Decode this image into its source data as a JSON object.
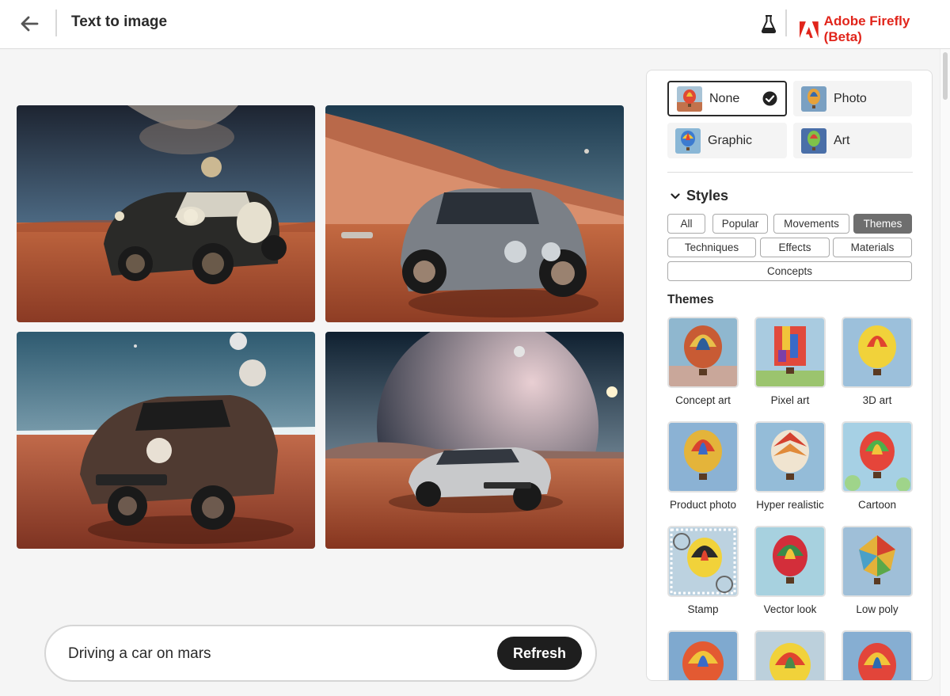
{
  "header": {
    "title": "Text to image",
    "brand_name": "Adobe Firefly (Beta)",
    "brand_color": "#e1251b",
    "back_icon": "arrow-left-icon",
    "labs_icon": "flask-icon"
  },
  "results": {
    "images": [
      {
        "alt": "Vintage car on mars with milky way"
      },
      {
        "alt": "Round silver car in red desert canyon"
      },
      {
        "alt": "Brown sports car with moons overhead"
      },
      {
        "alt": "Silver sports car with giant planet"
      }
    ]
  },
  "prompt": {
    "value": "Driving a car on mars",
    "refresh_label": "Refresh"
  },
  "panel": {
    "content_types": [
      {
        "label": "None",
        "selected": true
      },
      {
        "label": "Photo",
        "selected": false
      },
      {
        "label": "Graphic",
        "selected": false
      },
      {
        "label": "Art",
        "selected": false
      }
    ],
    "styles_title": "Styles",
    "style_tabs": [
      {
        "label": "All"
      },
      {
        "label": "Popular"
      },
      {
        "label": "Movements"
      },
      {
        "label": "Themes",
        "active": true
      },
      {
        "label": "Techniques"
      },
      {
        "label": "Effects"
      },
      {
        "label": "Materials"
      },
      {
        "label": "Concepts"
      }
    ],
    "themes_title": "Themes",
    "themes": [
      {
        "label": "Concept art"
      },
      {
        "label": "Pixel art"
      },
      {
        "label": "3D art"
      },
      {
        "label": "Product photo"
      },
      {
        "label": "Hyper realistic"
      },
      {
        "label": "Cartoon"
      },
      {
        "label": "Stamp"
      },
      {
        "label": "Vector look"
      },
      {
        "label": "Low poly"
      },
      {
        "label": ""
      },
      {
        "label": ""
      },
      {
        "label": ""
      }
    ]
  }
}
